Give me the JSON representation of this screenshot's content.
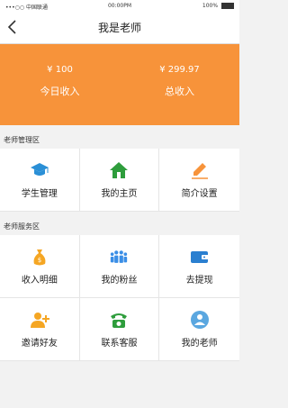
{
  "status_bar": {
    "carrier": "•••○○ 中国联通",
    "time": "00:00PM",
    "battery": "100%"
  },
  "header": {
    "title": "我是老师"
  },
  "banner": {
    "today_amount": "¥ 100",
    "today_label": "今日收入",
    "total_amount": "¥ 299.97",
    "total_label": "总收入"
  },
  "management": {
    "section_title": "老师管理区",
    "items": [
      {
        "label": "学生管理",
        "icon": "graduation-cap-icon",
        "color": "#2a8fd6"
      },
      {
        "label": "我的主页",
        "icon": "home-icon",
        "color": "#2e9d3c"
      },
      {
        "label": "简介设置",
        "icon": "edit-icon",
        "color": "#f7933a"
      }
    ]
  },
  "service": {
    "section_title": "老师服务区",
    "items": [
      {
        "label": "收入明细",
        "icon": "money-bag-icon",
        "color": "#f5a623"
      },
      {
        "label": "我的粉丝",
        "icon": "fans-icon",
        "color": "#3a8ee6"
      },
      {
        "label": "去提现",
        "icon": "wallet-icon",
        "color": "#2a7fd0"
      },
      {
        "label": "邀请好友",
        "icon": "add-user-icon",
        "color": "#f5a623"
      },
      {
        "label": "联系客服",
        "icon": "phone-icon",
        "color": "#2e9d3c"
      },
      {
        "label": "我的老师",
        "icon": "teacher-icon",
        "color": "#5aa7e0"
      }
    ]
  },
  "colors": {
    "accent": "#f7933a"
  }
}
